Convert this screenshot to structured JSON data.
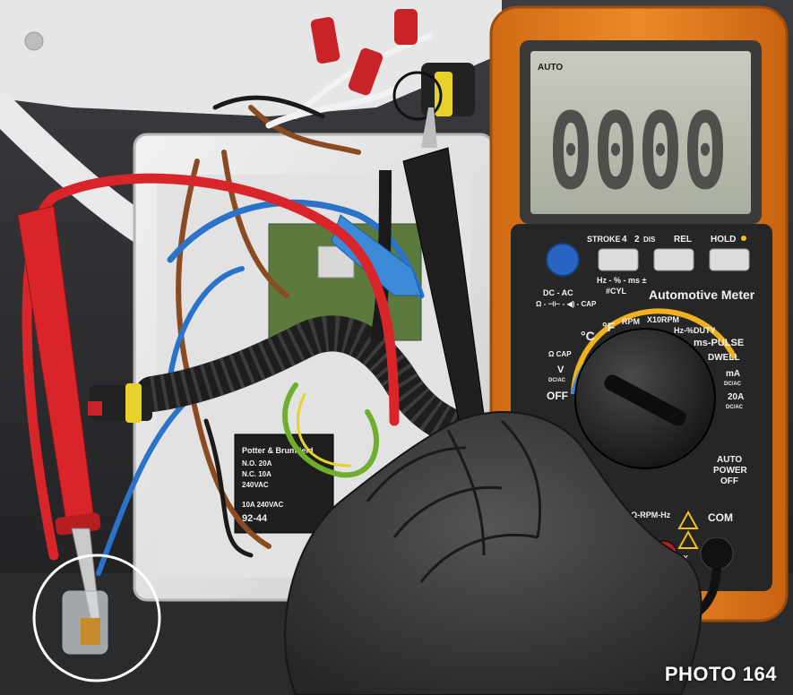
{
  "photo_label": "PHOTO 164",
  "meter": {
    "display_mode": "AUTO",
    "display_reading": "0000",
    "buttons": {
      "stroke_label": "STROKE",
      "stroke_4": "4",
      "stroke_2": "2",
      "dis_label": "DIS",
      "rel_label": "REL",
      "hold_label": "HOLD",
      "func_label": "Hz - % - ms ±",
      "cyl_label": "#CYL"
    },
    "dc_ac_label": "DC - AC",
    "cap_label": "Ω - ⊣⊢ - ◀) - CAP",
    "title": "Automotive Meter",
    "dial": {
      "rpm": "RPM",
      "x10rpm": "X10RPM",
      "hz_duty": "Hz-%DUTY",
      "ms_pulse": "ms-PULSE",
      "dwell": "DWELL",
      "ma": "mA",
      "ma_sub": "DC/AC",
      "a20": "20A",
      "a20_sub": "DC/AC",
      "celsius": "°C",
      "fahrenheit": "°F",
      "ohm_cap": "Ω CAP",
      "volt": "V",
      "volt_sub": "DC/AC",
      "off": "OFF"
    },
    "auto_power_off": [
      "AUTO",
      "POWER",
      "OFF"
    ],
    "com_label": "COM",
    "jack_label": "Ω-RPM-Hz",
    "max_label": "MAX"
  },
  "relay": {
    "brand": "Potter & Brumfield",
    "lines": [
      "N.O. 20A",
      "N.C. 10A",
      "240VAC"
    ],
    "model": "92-44",
    "rating": "10A 240VAC"
  },
  "colors": {
    "meter_body": "#e07a1a",
    "meter_face": "#262626",
    "lcd": "#b9bdb0",
    "probe_red": "#d9242a",
    "glove": "#3a3a3a",
    "wire_blue": "#2a73c9",
    "wire_brown": "#8a4a22"
  }
}
